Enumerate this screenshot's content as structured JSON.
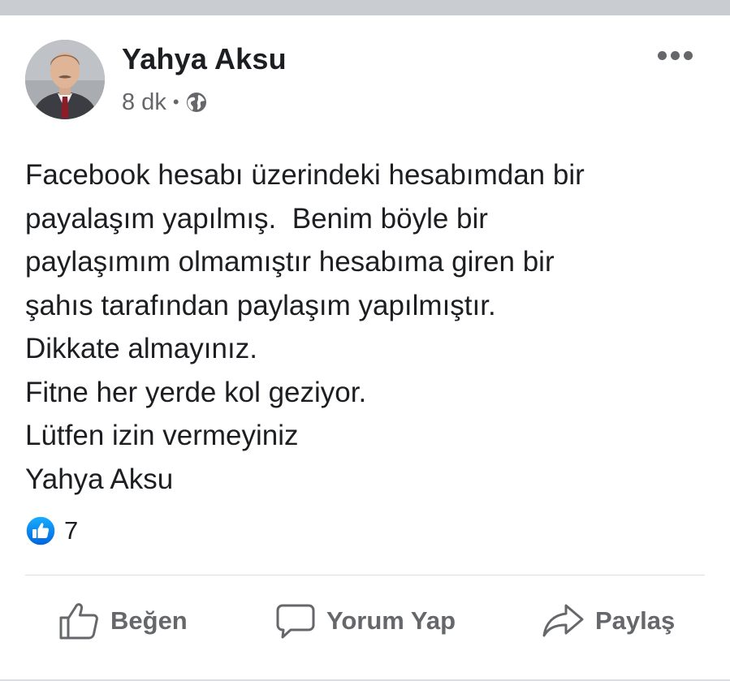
{
  "post": {
    "author": "Yahya Aksu",
    "time": "8 dk",
    "separator": "•",
    "privacy_icon": "globe-icon",
    "text_lines": [
      "Facebook hesabı üzerindeki hesabımdan bir",
      "payalaşım yapılmış.  Benim böyle bir",
      "paylaşımım olmamıştır hesabıma giren bir",
      "şahıs tarafından paylaşım yapılmıştır.",
      "Dikkate almayınız.",
      "Fitne her yerde kol geziyor.",
      "Lütfen izin vermeyiniz",
      "Yahya Aksu"
    ],
    "reactions": {
      "icon": "like-icon",
      "count": "7"
    }
  },
  "actions": {
    "like": "Beğen",
    "comment": "Yorum Yap",
    "share": "Paylaş"
  },
  "colors": {
    "like_blue": "#1877f2",
    "secondary_text": "#65676b",
    "divider": "#dadde1",
    "top_bar": "#c9ccd1"
  }
}
